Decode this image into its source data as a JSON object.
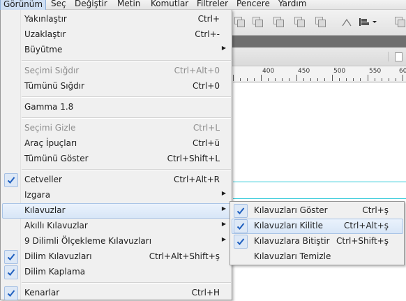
{
  "menubar": {
    "items": [
      "Görünüm",
      "Seç",
      "Değiştir",
      "Metin",
      "Komutlar",
      "Filtreler",
      "Pencere",
      "Yardım"
    ]
  },
  "ruler": {
    "labels": [
      "400",
      "450",
      "500",
      "550",
      "60"
    ]
  },
  "menu": {
    "items": [
      {
        "label": "Yakınlaştır",
        "shortcut": "Ctrl+"
      },
      {
        "label": "Uzaklaştır",
        "shortcut": "Ctrl+-"
      },
      {
        "label": "Büyütme",
        "shortcut": ""
      },
      {
        "label": "Seçimi Sığdır",
        "shortcut": "Ctrl+Alt+0",
        "disabled": true
      },
      {
        "label": "Tümünü Sığdır",
        "shortcut": "Ctrl+0"
      },
      {
        "label": "Gamma 1.8",
        "shortcut": ""
      },
      {
        "label": "Seçimi Gizle",
        "shortcut": "Ctrl+L",
        "disabled": true
      },
      {
        "label": "Araç İpuçları",
        "shortcut": "Ctrl+ü"
      },
      {
        "label": "Tümünü Göster",
        "shortcut": "Ctrl+Shift+L"
      },
      {
        "label": "Cetveller",
        "shortcut": "Ctrl+Alt+R",
        "checked": true
      },
      {
        "label": "Izgara",
        "shortcut": ""
      },
      {
        "label": "Kılavuzlar",
        "shortcut": "",
        "highlighted": true
      },
      {
        "label": "Akıllı Kılavuzlar",
        "shortcut": ""
      },
      {
        "label": "9 Dilimli Ölçekleme Kılavuzları",
        "shortcut": ""
      },
      {
        "label": "Dilim Kılavuzları",
        "shortcut": "Ctrl+Alt+Shift+ş",
        "checked": true
      },
      {
        "label": "Dilim Kaplama",
        "shortcut": "",
        "checked": true
      },
      {
        "label": "Kenarlar",
        "shortcut": "Ctrl+H",
        "checked": true
      }
    ]
  },
  "submenu": {
    "items": [
      {
        "label": "Kılavuzları Göster",
        "shortcut": "Ctrl+ş",
        "checked": true
      },
      {
        "label": "Kılavuzları Kilitle",
        "shortcut": "Ctrl+Alt+ş",
        "checked": true,
        "highlighted": true
      },
      {
        "label": "Kılavuzlara Bitiştir",
        "shortcut": "Ctrl+Shift+ş",
        "checked": true
      },
      {
        "label": "Kılavuzları Temizle",
        "shortcut": ""
      }
    ]
  },
  "colors": {
    "guide": "#2ac8d8",
    "highlight": "#d8e6f7",
    "check": "#1f5fbf"
  },
  "icons": {
    "check": "check-icon",
    "arrow": "submenu-arrow-icon"
  }
}
